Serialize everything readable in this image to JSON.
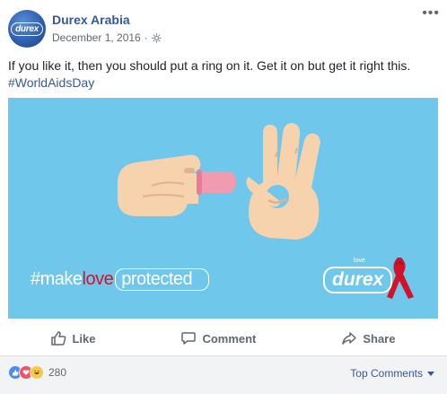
{
  "header": {
    "avatar_logo": "durex",
    "page_name": "Durex Arabia",
    "date": "December 1, 2016",
    "separator": "·"
  },
  "post": {
    "text": "If you like it, then you should put a ring on it. Get it on but get it right this.",
    "hashtag": "#WorldAidsDay"
  },
  "image": {
    "background": "#6fc8ec",
    "tagline_prefix": "#make",
    "tagline_love": "love",
    "tagline_protected": "protected",
    "brand_small": "love",
    "brand_logo": "durex"
  },
  "actions": {
    "like": "Like",
    "comment": "Comment",
    "share": "Share"
  },
  "footer": {
    "reaction_count": "280",
    "top_comments": "Top Comments"
  }
}
